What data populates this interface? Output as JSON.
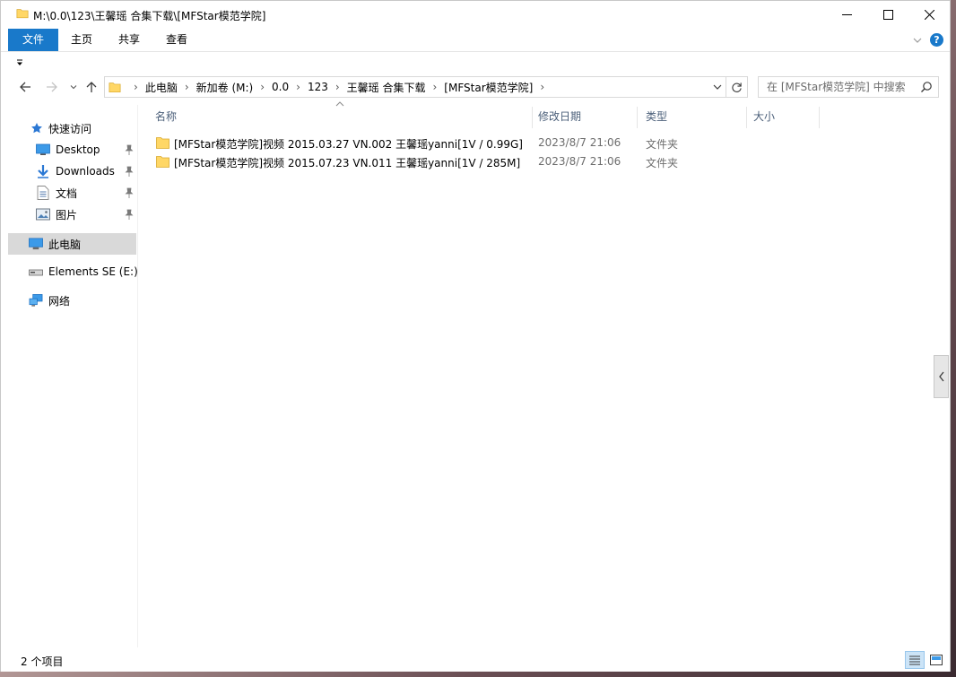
{
  "window": {
    "title": "M:\\0.0\\123\\王馨瑶 合集下载\\[MFStar模范学院]"
  },
  "ribbon": {
    "tabs": [
      "文件",
      "主页",
      "共享",
      "查看"
    ],
    "help": "?"
  },
  "address": {
    "crumbs": [
      "此电脑",
      "新加卷 (M:)",
      "0.0",
      "123",
      "王馨瑶 合集下载",
      "[MFStar模范学院]"
    ],
    "separator": "›"
  },
  "search": {
    "placeholder": "在 [MFStar模范学院] 中搜索"
  },
  "navpane": {
    "quick_access": "快速访问",
    "items": [
      {
        "label": "Desktop",
        "icon": "desktop-icon",
        "pinned": true
      },
      {
        "label": "Downloads",
        "icon": "downloads-icon",
        "pinned": true
      },
      {
        "label": "文档",
        "icon": "documents-icon",
        "pinned": true
      },
      {
        "label": "图片",
        "icon": "pictures-icon",
        "pinned": true
      }
    ],
    "this_pc": "此电脑",
    "drive": "Elements SE (E:)",
    "network": "网络"
  },
  "columns": {
    "name": "名称",
    "date": "修改日期",
    "type": "类型",
    "size": "大小"
  },
  "files": [
    {
      "name": "[MFStar模范学院]视频 2015.03.27 VN.002 王馨瑶yanni[1V / 0.99G]",
      "date": "2023/8/7 21:06",
      "type": "文件夹"
    },
    {
      "name": "[MFStar模范学院]视频 2015.07.23 VN.011 王馨瑶yanni[1V / 285M]",
      "date": "2023/8/7 21:06",
      "type": "文件夹"
    }
  ],
  "status": {
    "count": "2 个项目"
  },
  "colors": {
    "accent": "#1979ca",
    "folder": "#ffd766",
    "selected_nav": "#d9d9d9"
  }
}
